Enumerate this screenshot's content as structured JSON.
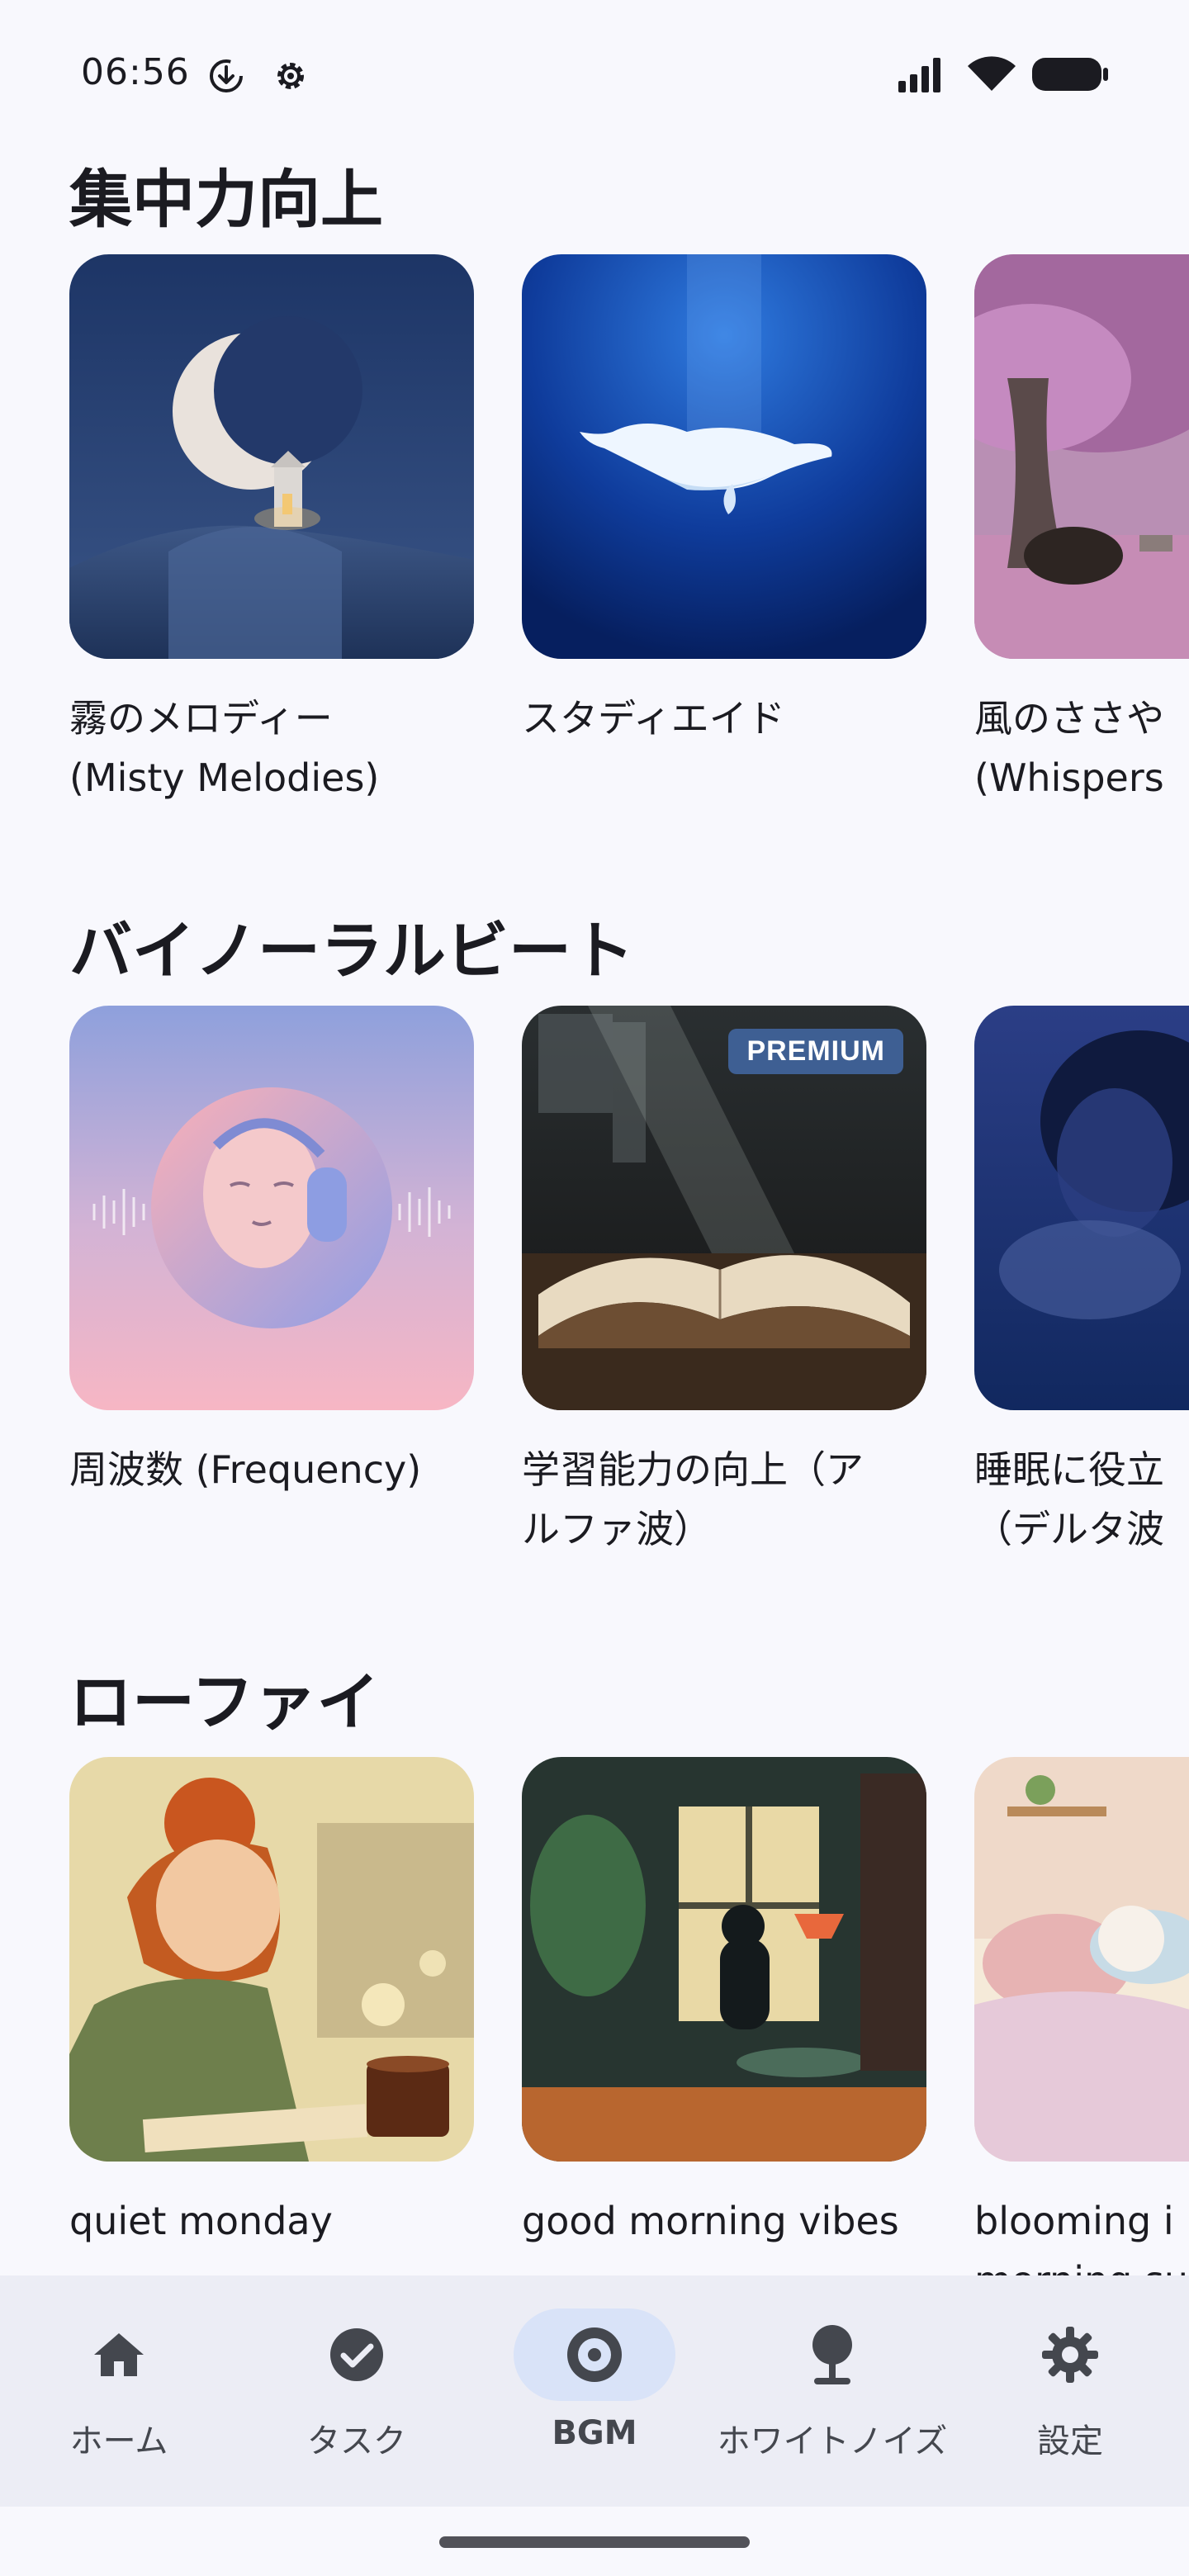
{
  "status_bar": {
    "time": "06:56",
    "left_icons": [
      "download-circle-icon",
      "gear-icon"
    ],
    "right_icons": [
      "signal-icon",
      "wifi-icon",
      "battery-icon"
    ]
  },
  "sections": [
    {
      "title": "集中力向上",
      "cards": [
        {
          "label": "霧のメロディー\n(Misty Melodies)",
          "art": "moon-lighthouse-night",
          "premium": false
        },
        {
          "label": "スタディエイド",
          "art": "white-whale-deep-blue",
          "premium": false
        },
        {
          "label": "風のささや\n(Whispers",
          "art": "pink-tree-yak",
          "premium": false
        }
      ]
    },
    {
      "title": "バイノーラルビート",
      "cards": [
        {
          "label": "周波数 (Frequency)",
          "art": "face-headphones-gradient",
          "premium": false
        },
        {
          "label": "学習能力の向上（ア\nルファ波）",
          "art": "open-book-library",
          "premium": true
        },
        {
          "label": "睡眠に役立\n（デルタ波",
          "art": "sleeping-person-blue",
          "premium": false
        }
      ],
      "premium_badge": "PREMIUM"
    },
    {
      "title": "ローファイ",
      "cards": [
        {
          "label": "quiet monday",
          "art": "girl-writing-coffee",
          "premium": false
        },
        {
          "label": "good morning vibes",
          "art": "girl-window-room",
          "premium": false
        },
        {
          "label": "blooming i\nmorning su",
          "art": "cozy-bed-cat",
          "premium": false
        }
      ]
    }
  ],
  "bottom_nav": {
    "items": [
      {
        "label": "ホーム",
        "icon": "home-icon",
        "active": false
      },
      {
        "label": "タスク",
        "icon": "check-circle-icon",
        "active": false
      },
      {
        "label": "BGM",
        "icon": "disc-icon",
        "active": true
      },
      {
        "label": "ホワイトノイズ",
        "icon": "white-noise-icon",
        "active": false
      },
      {
        "label": "設定",
        "icon": "settings-icon",
        "active": false
      }
    ]
  },
  "colors": {
    "background": "#f8f8fd",
    "nav_background": "#ecedf5",
    "nav_active_pill": "#d9e3f8",
    "premium_badge": "#3e5f93",
    "text": "#1b1b21"
  }
}
